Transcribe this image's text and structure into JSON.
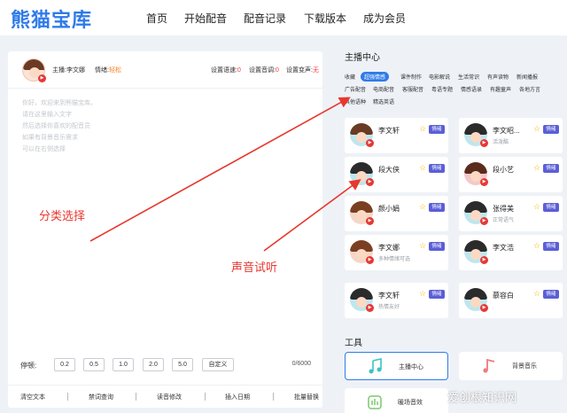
{
  "nav": {
    "logo": "熊猫宝库",
    "items": [
      "首页",
      "开始配音",
      "配音记录",
      "下载版本",
      "成为会员"
    ]
  },
  "editor": {
    "anchor_label": "主播:李文娜",
    "mood_label": "情绪:",
    "mood_value": "轻松",
    "speed_label": "设置语速:",
    "speed_value": "0",
    "tone_label": "设置音调:",
    "tone_value": "0",
    "change_label": "设置变声:",
    "change_value": "无",
    "placeholder_lines": [
      "你好，欢迎来到熊猫宝库。",
      "请在这里输入文字",
      "然后选择你喜欢的配音员",
      "如果有背景音乐需求",
      "可以在右侧选择"
    ],
    "pause_label": "停顿:",
    "pause_options": [
      "0.2",
      "0.5",
      "1.0",
      "2.0",
      "5.0",
      "自定义"
    ],
    "char_count": "0/6000",
    "footer_actions": [
      "清空文本",
      "禁词查询",
      "读音修改",
      "插入日期",
      "批量替换"
    ]
  },
  "anchor_center": {
    "title": "主播中心",
    "categories_row1": [
      "收藏",
      "超强情感",
      "课件制作",
      "电影解说",
      "生活常识",
      "有声读物",
      "新闻播报"
    ],
    "categories_row2": [
      "广告配音",
      "电商配音",
      "客服配音",
      "粤语专题",
      "情感语录",
      "有趣童声",
      "各地方言"
    ],
    "categories_row3": [
      "其他语种",
      "精选英语"
    ],
    "active_category": "超强情感",
    "anchors": [
      {
        "name": "李文轩",
        "sub": "",
        "hair": "#6b3a25",
        "badge": "情绪"
      },
      {
        "name": "李文昭...",
        "sub": "活泼酷",
        "hair": "#2b2b2b",
        "badge": "情绪"
      },
      {
        "name": "段大侠",
        "sub": "",
        "hair": "#2b2b2b",
        "badge": "情绪"
      },
      {
        "name": "段小艺",
        "sub": "",
        "hair": "#5a2c1c",
        "badge": "情绪"
      },
      {
        "name": "颜小娟",
        "sub": "",
        "hair": "#7a3f22",
        "badge": "情绪"
      },
      {
        "name": "张得美",
        "sub": "正常语气",
        "hair": "#2b2b2b",
        "badge": "情绪"
      },
      {
        "name": "李文娜",
        "sub": "多种情绪可选",
        "hair": "#7a3f22",
        "badge": "情绪"
      },
      {
        "name": "李文浩",
        "sub": "",
        "hair": "#2b2b2b",
        "badge": "情绪"
      },
      {
        "name": "李文轩",
        "sub": "热情友好",
        "hair": "#2b2b2b",
        "badge": "情绪"
      },
      {
        "name": "慕容白",
        "sub": "",
        "hair": "#2b2b2b",
        "badge": "情绪"
      }
    ]
  },
  "tools": {
    "title": "工具",
    "items": [
      "主播中心",
      "背景音乐",
      "暖场音效"
    ],
    "icons": [
      "music-note-icon",
      "music-icon",
      "sound-effect-icon"
    ]
  },
  "annotations": {
    "category_select": "分类选择",
    "voice_preview": "声音试听"
  },
  "watermark": "爱创根知识网",
  "colors": {
    "brand": "#2f7be8",
    "annotation": "#e8372f",
    "badge": "#5b5fd6",
    "play": "#e53935"
  }
}
